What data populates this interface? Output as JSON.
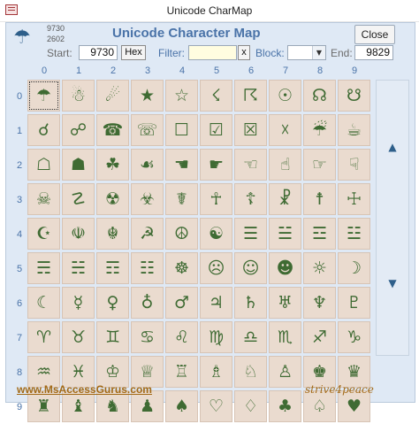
{
  "window": {
    "title": "Unicode CharMap"
  },
  "header": {
    "preview_char": "☂",
    "preview_code": "9730",
    "preview_hex": "2602",
    "title": "Unicode Character Map",
    "close_label": "Close",
    "start_label": "Start:",
    "start_value": "9730",
    "hex_label": "Hex",
    "filter_label": "Filter:",
    "filter_value": "",
    "filter_clear_label": "x",
    "block_label": "Block:",
    "block_value": "",
    "end_label": "End:",
    "end_value": "9829"
  },
  "grid": {
    "columns": [
      "0",
      "1",
      "2",
      "3",
      "4",
      "5",
      "6",
      "7",
      "8",
      "9"
    ],
    "rows": [
      "0",
      "1",
      "2",
      "3",
      "4",
      "5",
      "6",
      "7",
      "8",
      "9"
    ],
    "chars": [
      [
        "☂",
        "☃",
        "☄",
        "★",
        "☆",
        "☇",
        "☈",
        "☉",
        "☊",
        "☋"
      ],
      [
        "☌",
        "☍",
        "☎",
        "☏",
        "☐",
        "☑",
        "☒",
        "☓",
        "☔",
        "☕"
      ],
      [
        "☖",
        "☗",
        "☘",
        "☙",
        "☚",
        "☛",
        "☜",
        "☝",
        "☞",
        "☟"
      ],
      [
        "☠",
        "☡",
        "☢",
        "☣",
        "☤",
        "☥",
        "☦",
        "☧",
        "☨",
        "☩"
      ],
      [
        "☪",
        "☫",
        "☬",
        "☭",
        "☮",
        "☯",
        "☰",
        "☱",
        "☲",
        "☳"
      ],
      [
        "☴",
        "☵",
        "☶",
        "☷",
        "☸",
        "☹",
        "☺",
        "☻",
        "☼",
        "☽"
      ],
      [
        "☾",
        "☿",
        "♀",
        "♁",
        "♂",
        "♃",
        "♄",
        "♅",
        "♆",
        "♇"
      ],
      [
        "♈",
        "♉",
        "♊",
        "♋",
        "♌",
        "♍",
        "♎",
        "♏",
        "♐",
        "♑"
      ],
      [
        "♒",
        "♓",
        "♔",
        "♕",
        "♖",
        "♗",
        "♘",
        "♙",
        "♚",
        "♛"
      ],
      [
        "♜",
        "♝",
        "♞",
        "♟",
        "♠",
        "♡",
        "♢",
        "♣",
        "♤",
        "♥"
      ]
    ]
  },
  "nav": {
    "up": "▲",
    "down": "▼"
  },
  "footer": {
    "link": "www.MsAccessGurus.com",
    "brand": "strive4peace"
  },
  "colors": {
    "cell_bg": "#eadbcf",
    "glyph": "#3f6b33",
    "accent": "#4a73a8",
    "footer": "#a36a17"
  }
}
